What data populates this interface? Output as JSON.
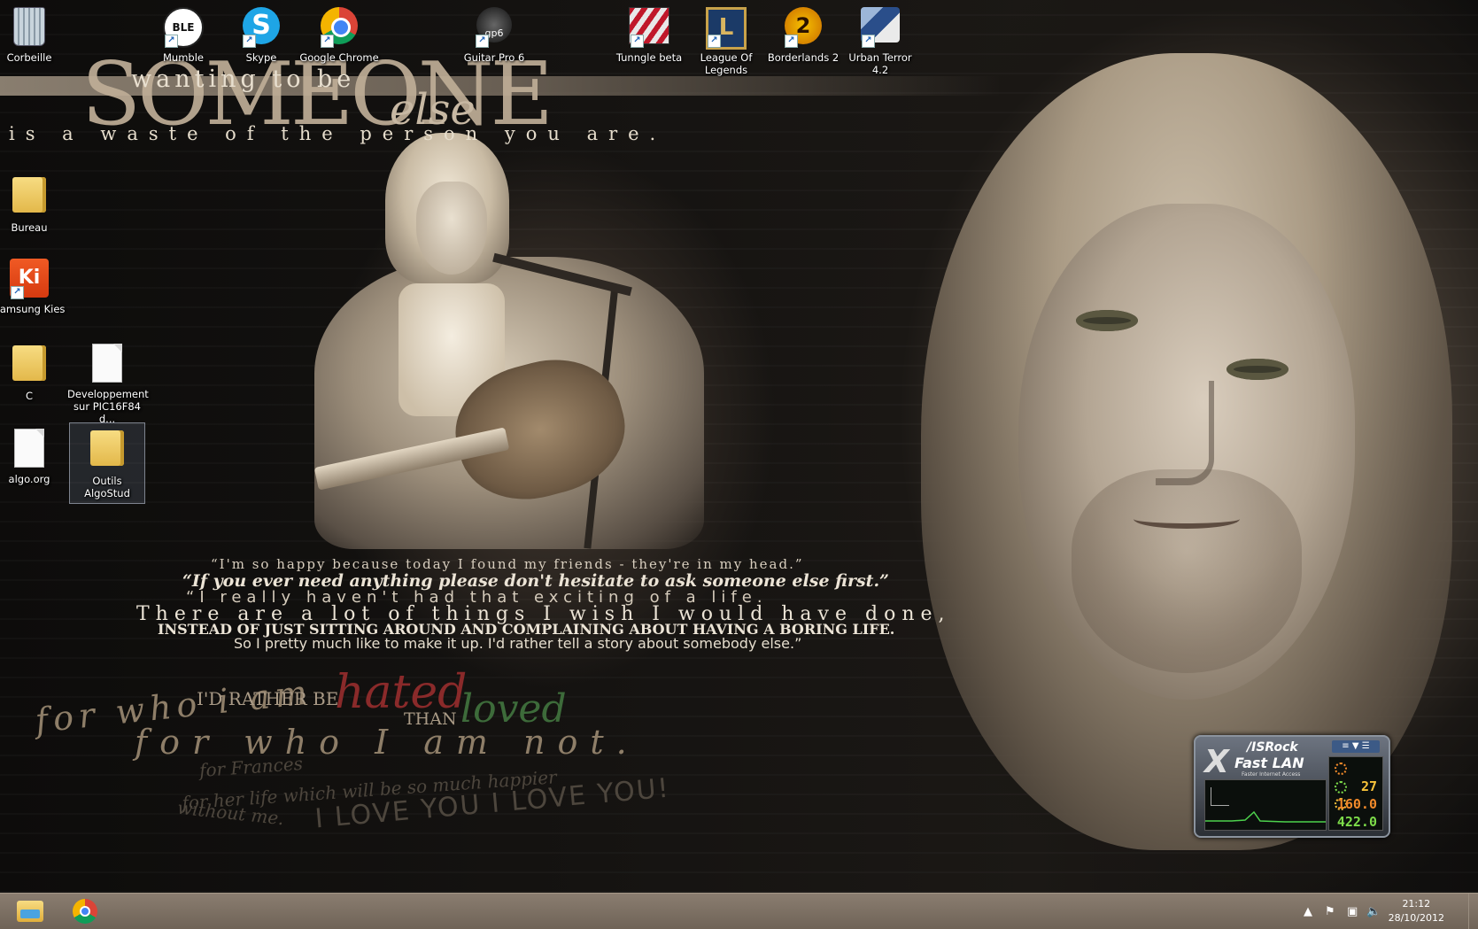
{
  "wallpaper": {
    "headline_small": "wanting to be",
    "headline_big": "SOMEONE",
    "headline_else": "else",
    "headline_sub": "is a waste of the person you are.",
    "quote_1": "“I'm so happy because today I found my friends - they're in my head.”",
    "quote_2": "“If you ever need anything please don't hesitate to ask someone else first.”",
    "quote_3": "“I really haven't had that exciting of a life.",
    "quote_4": "There are a lot of things I wish I would have done,",
    "quote_5": "INSTEAD OF JUST SITTING AROUND AND COMPLAINING ABOUT HAVING A BORING LIFE.",
    "quote_6": "So I pretty much like to make it up. I'd rather tell a story about somebody else.”",
    "rather": "I'D RATHER BE",
    "hated": "hated",
    "than": "THAN",
    "loved": "loved",
    "who_i_am": "for who i am",
    "who_i_am_not": "for who I am not.",
    "frances_1": "for Frances",
    "frances_2": "for her life which will be so much happier",
    "frances_3": "without me.",
    "i_love_you": "I LOVE YOU I LOVE YOU!"
  },
  "desktop_icons": [
    {
      "label": "Corbeille",
      "icon": "recycle-bin-icon"
    },
    {
      "label": "Mumble",
      "icon": "mumble-icon",
      "glyph": "BLE"
    },
    {
      "label": "Skype",
      "icon": "skype-icon",
      "glyph": "S"
    },
    {
      "label": "Google Chrome",
      "icon": "chrome-icon"
    },
    {
      "label": "Guitar Pro 6",
      "icon": "guitar-pro-icon",
      "glyph": "gp6"
    },
    {
      "label": "Tunngle beta",
      "icon": "tunngle-icon"
    },
    {
      "label": "League Of Legends",
      "icon": "league-of-legends-icon",
      "glyph": "L"
    },
    {
      "label": "Borderlands 2",
      "icon": "borderlands-icon",
      "glyph": "2"
    },
    {
      "label": "Urban Terror 4.2",
      "icon": "urban-terror-icon"
    },
    {
      "label": "Bureau",
      "icon": "folder-icon"
    },
    {
      "label": "Samsung Kies",
      "icon": "samsung-kies-icon",
      "glyph": "Ki"
    },
    {
      "label": "C",
      "icon": "folder-icon"
    },
    {
      "label": "Developpement sur PIC16F84 d...",
      "icon": "document-icon"
    },
    {
      "label": "algo.org",
      "icon": "document-icon"
    },
    {
      "label": "Outils AlgoStud",
      "icon": "folder-icon"
    }
  ],
  "widget": {
    "brand": "/ISRock",
    "x": "X",
    "title": "Fast LAN",
    "subtitle": "Faster Internet Access",
    "value_1": "27",
    "value_2": "160.0",
    "value_3": "422.0",
    "menu_glyph": "≡ ▼ ☰"
  },
  "taskbar": {
    "time": "21:12",
    "date": "28/10/2012",
    "tray_chevron": "▲",
    "tray_flag": "⚑",
    "tray_network": "▣",
    "tray_volume": "🔈"
  },
  "colors": {
    "hated": "#8a2a2a",
    "loved": "#3d6b3a",
    "taskbar": "#7a6d60",
    "value_1": "#f7c23a",
    "value_2": "#f28a2a",
    "value_3": "#7ddc4a"
  }
}
